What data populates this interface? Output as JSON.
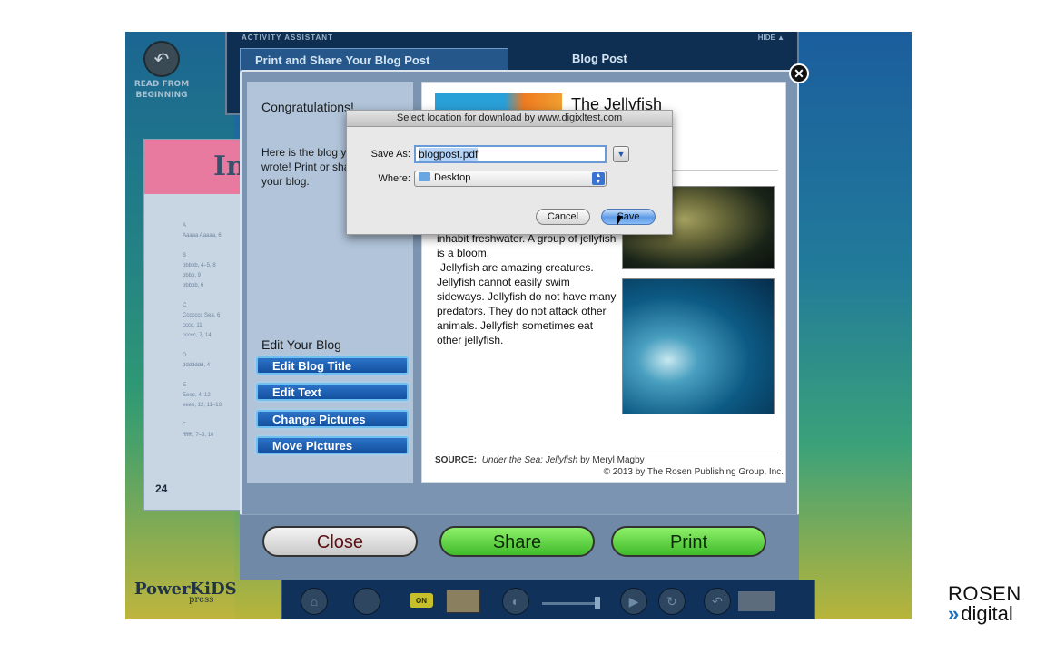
{
  "app": {
    "read_from_beginning": "READ FROM\nBEGINNING",
    "book_title": "In",
    "book_page_number": "24",
    "publisher_logo": "PowerKiDS",
    "publisher_logo_sub": "press"
  },
  "activity": {
    "header_label": "ACTIVITY ASSISTANT",
    "hide_label": "HIDE ▲",
    "tab_print": "Print and Share Your Blog Post",
    "tab_blog": "Blog Post"
  },
  "toolbar": {
    "on_label": "ON"
  },
  "left_panel": {
    "congrats": "Congratulations!",
    "intro": "Here is the blog you wrote! Print or share your blog.",
    "edit_heading": "Edit Your Blog",
    "buttons": [
      "Edit Blog Title",
      "Edit Text",
      "Change Pictures",
      "Move Pictures"
    ]
  },
  "blog": {
    "title": "The Jellyfish",
    "paragraph1": "inhabit freshwater. A group of jellyfish is a bloom.",
    "paragraph2": "Jellyfish are amazing creatures. Jellyfish cannot easily swim sideways. Jellyfish do not have many predators. They do not attack other animals. Jellyfish sometimes eat other jellyfish.",
    "source_label": "SOURCE:",
    "source_book": "Under the Sea: Jellyfish",
    "source_author": "by Meryl Magby",
    "copyright": "© 2013 by The Rosen Publishing Group, Inc."
  },
  "actions": {
    "close": "Close",
    "share": "Share",
    "print": "Print"
  },
  "save_dialog": {
    "title": "Select location for download by www.digixltest.com",
    "save_as_label": "Save As:",
    "filename": "blogpost.pdf",
    "where_label": "Where:",
    "where_value": "Desktop",
    "cancel": "Cancel",
    "save": "Save"
  },
  "brand": {
    "line1": "ROSEN",
    "line2": "digital",
    "accent_color": "#1e6fc0"
  }
}
